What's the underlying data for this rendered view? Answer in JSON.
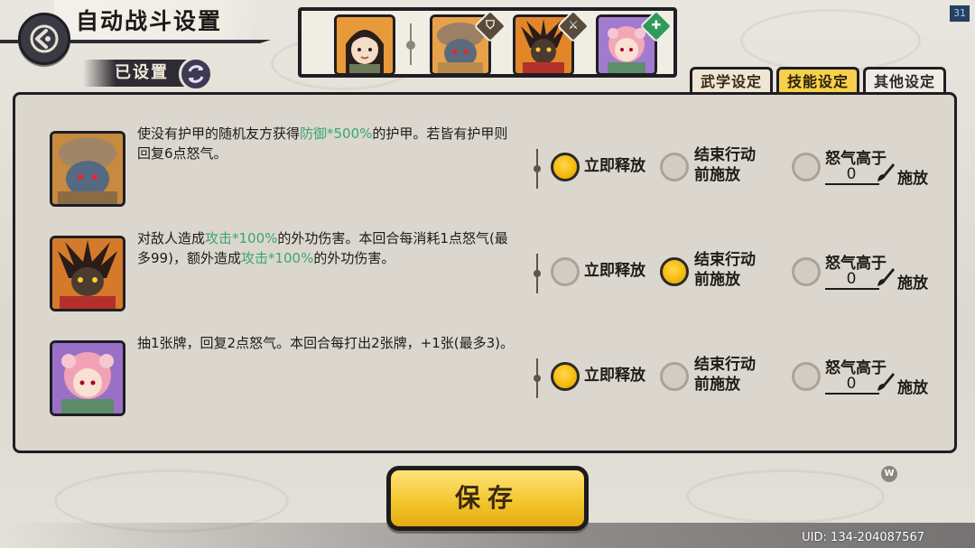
{
  "header": {
    "title": "自动战斗设置",
    "status_label": "已设置",
    "fps": "31"
  },
  "team": {
    "members": [
      {
        "name": "main-character",
        "badge": ""
      },
      {
        "name": "member-1",
        "badge": "shield"
      },
      {
        "name": "member-2",
        "badge": "sword"
      },
      {
        "name": "member-3",
        "badge": "heal"
      }
    ]
  },
  "tabs": [
    {
      "label": "武学设定",
      "active": false
    },
    {
      "label": "技能设定",
      "active": true
    },
    {
      "label": "其他设定",
      "active": false
    }
  ],
  "options": {
    "immediate": "立即释放",
    "end_action_line1": "结束行动",
    "end_action_line2": "前施放",
    "rage_line1": "怒气高于",
    "rage_suffix": "施放"
  },
  "skills": [
    {
      "desc_parts": [
        "使没有护甲的随机友方获得",
        "防御*500%",
        "的护甲。若皆有护甲则回复6点怒气。"
      ],
      "selected": "immediate",
      "rage_value": "0"
    },
    {
      "desc_parts": [
        "对敌人造成",
        "攻击*100%",
        "的外功伤害。本回合每消耗1点怒气(最多99)，额外造成",
        "攻击*100%",
        "的外功伤害。"
      ],
      "selected": "end_action",
      "rage_value": "0"
    },
    {
      "desc_parts": [
        "抽1张牌，回复2点怒气。本回合每打出2张牌，+1张(最多3)。"
      ],
      "selected": "immediate",
      "rage_value": "0"
    }
  ],
  "save_label": "保存",
  "w_badge": "W",
  "uid": "UID: 134-204087567",
  "colors": {
    "accent_yellow": "#f4c72f",
    "highlight_green": "#3aa572",
    "dark_border": "#1f1e22"
  }
}
